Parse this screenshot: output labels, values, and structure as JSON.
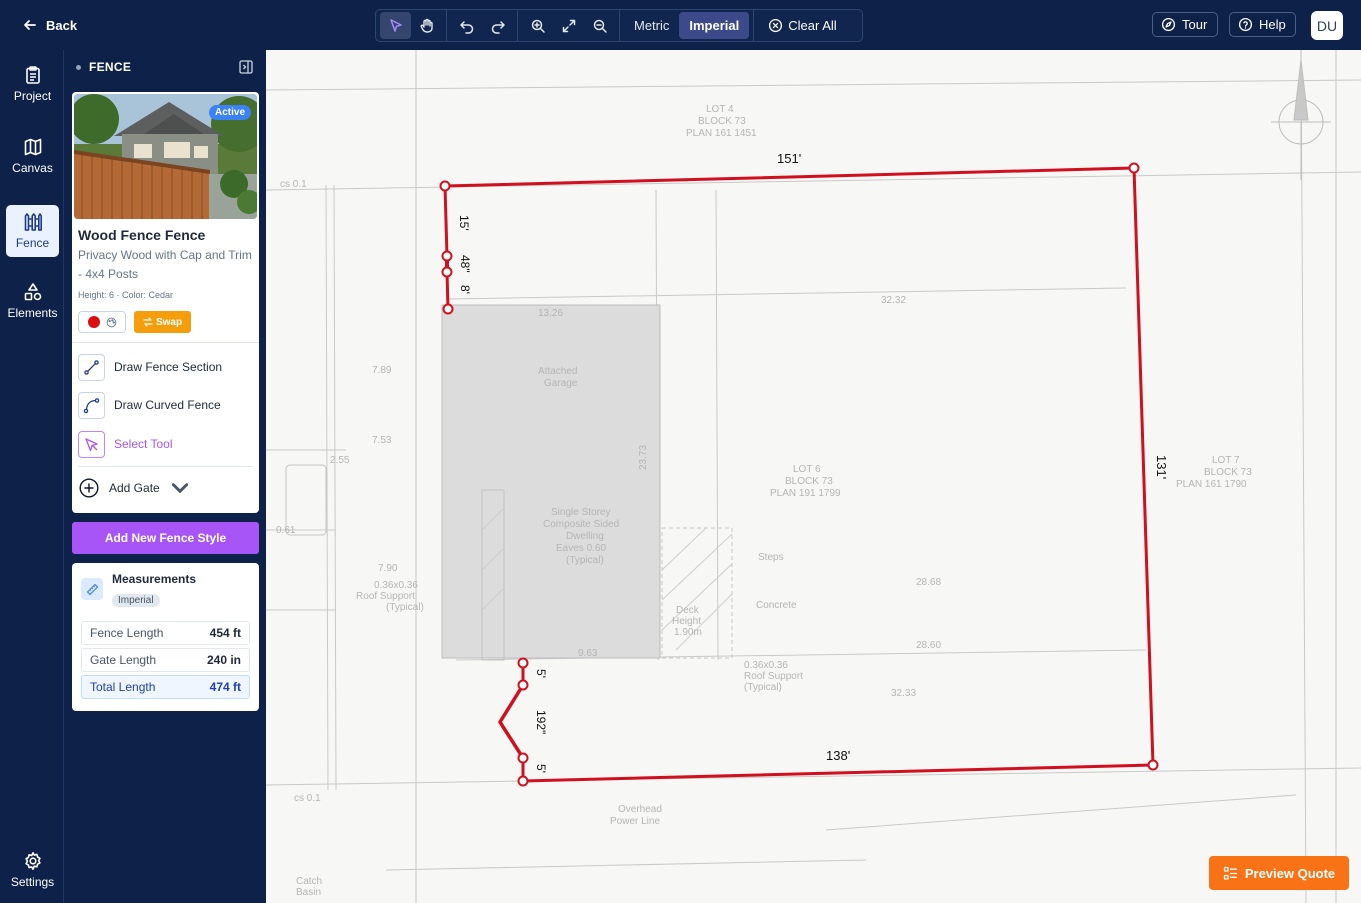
{
  "header": {
    "back_label": "Back",
    "units": {
      "metric": "Metric",
      "imperial": "Imperial",
      "active": "Imperial"
    },
    "clear_all_label": "Clear All",
    "tour_label": "Tour",
    "help_label": "Help",
    "user_initials": "DU"
  },
  "rail": {
    "items": [
      {
        "label": "Project",
        "icon": "clipboard-icon"
      },
      {
        "label": "Canvas",
        "icon": "map-icon"
      },
      {
        "label": "Fence",
        "icon": "fence-icon",
        "active": true
      },
      {
        "label": "Elements",
        "icon": "shapes-icon"
      }
    ],
    "settings_label": "Settings"
  },
  "panel": {
    "section_title": "FENCE",
    "product": {
      "badge": "Active",
      "title": "Wood Fence Fence",
      "description": "Privacy Wood with Cap and Trim - 4x4 Posts",
      "meta": "Height: 6 · Color: Cedar",
      "color_hex": "#dc0f0f",
      "swap_label": "Swap"
    },
    "tools": {
      "draw_section": "Draw Fence Section",
      "draw_curved": "Draw Curved Fence",
      "select": "Select Tool",
      "add_gate": "Add Gate"
    },
    "add_style_label": "Add New Fence Style",
    "measurements": {
      "title": "Measurements",
      "unit": "Imperial",
      "rows": [
        {
          "label": "Fence Length",
          "value": "454 ft"
        },
        {
          "label": "Gate Length",
          "value": "240 in"
        },
        {
          "label": "Total Length",
          "value": "474 ft"
        }
      ]
    }
  },
  "canvas": {
    "fence_color": "#d0101e",
    "segment_labels": {
      "top": "151'",
      "right": "131'",
      "bottom": "138'",
      "left_top": "15'",
      "left_gate": "48\"",
      "left_short": "8'",
      "gate_top": "5'",
      "gate_mid": "192\"",
      "gate_bottom": "5'"
    },
    "plan_text": {
      "lot4": [
        "LOT 4",
        "BLOCK 73",
        "PLAN 161 1451"
      ],
      "lot6": [
        "LOT 6",
        "BLOCK 73",
        "PLAN 191 1799"
      ],
      "lot7": [
        "LOT 7",
        "BLOCK 73",
        "PLAN 161 1790"
      ],
      "house": [
        "Single Storey",
        "Composite Sided",
        "Dwelling",
        "Eaves 0.60",
        "(Typical)"
      ],
      "garage": [
        "Attached",
        "Garage"
      ],
      "dims": [
        "32.32",
        "28.68",
        "28.60",
        "32.33",
        "13.26",
        "7.89",
        "7.53",
        "2.55",
        "7.90",
        "0.61",
        "23.73",
        "9.63"
      ],
      "steps": "Steps",
      "concrete": "Concrete",
      "roof": [
        "0.36x0.36",
        "Roof Support",
        "(Typical)"
      ],
      "overhead": [
        "Overhead",
        "Power Line"
      ],
      "catch": [
        "Catch",
        "Basin"
      ],
      "deck": [
        "Deck",
        "Height",
        "1.90m"
      ],
      "cs": "cs 0.1"
    },
    "preview_label": "Preview Quote"
  }
}
